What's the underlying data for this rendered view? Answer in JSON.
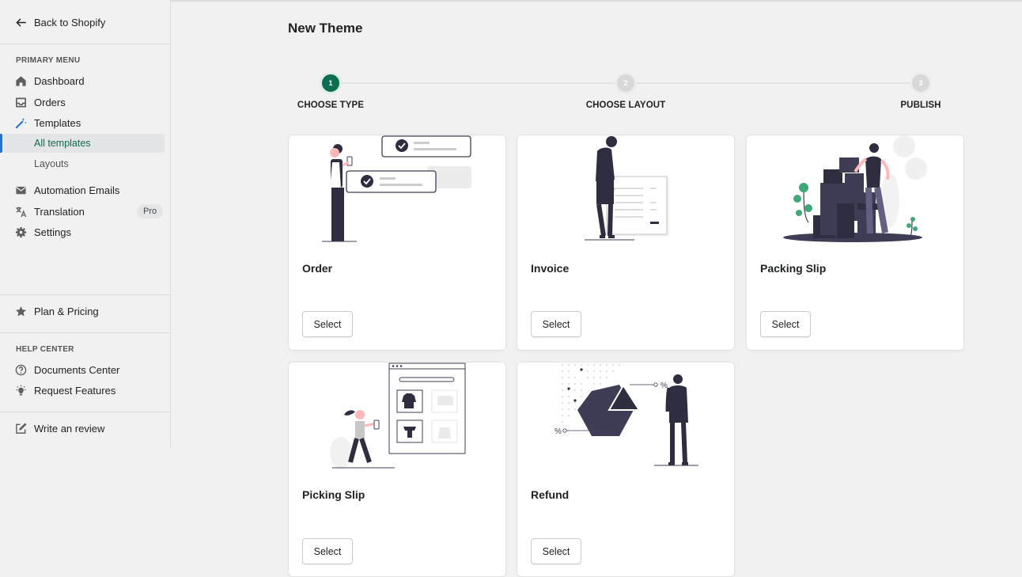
{
  "colors": {
    "accent": "#0b6e50",
    "active_bar": "#2c6ecb",
    "dark_figure": "#3f3d56"
  },
  "sidebar": {
    "back_label": "Back to Shopify",
    "primary_heading": "PRIMARY MENU",
    "items": [
      {
        "label": "Dashboard",
        "icon": "home-icon"
      },
      {
        "label": "Orders",
        "icon": "inbox-icon"
      },
      {
        "label": "Templates",
        "icon": "magic-wand-icon"
      }
    ],
    "sub_items": [
      {
        "label": "All templates",
        "active": true
      },
      {
        "label": "Layouts",
        "active": false
      }
    ],
    "items2": [
      {
        "label": "Automation Emails",
        "icon": "envelope-icon"
      },
      {
        "label": "Translation",
        "icon": "translate-icon",
        "badge": "Pro"
      },
      {
        "label": "Settings",
        "icon": "gear-icon"
      }
    ],
    "plan_label": "Plan & Pricing",
    "help_heading": "HELP CENTER",
    "help_items": [
      {
        "label": "Documents Center",
        "icon": "question-circle-icon"
      },
      {
        "label": "Request Features",
        "icon": "lightbulb-icon"
      }
    ],
    "review_label": "Write an review"
  },
  "main": {
    "title": "New Theme",
    "steps": [
      {
        "number": "1",
        "label": "CHOOSE TYPE",
        "state": "active"
      },
      {
        "number": "2",
        "label": "CHOOSE LAYOUT",
        "state": "pending"
      },
      {
        "number": "3",
        "label": "PUBLISH",
        "state": "pending"
      }
    ],
    "cards": [
      {
        "title": "Order",
        "button": "Select",
        "illustration": "order-illustration"
      },
      {
        "title": "Invoice",
        "button": "Select",
        "illustration": "invoice-illustration"
      },
      {
        "title": "Packing Slip",
        "button": "Select",
        "illustration": "packing-slip-illustration"
      },
      {
        "title": "Picking Slip",
        "button": "Select",
        "illustration": "picking-slip-illustration"
      },
      {
        "title": "Refund",
        "button": "Select",
        "illustration": "refund-illustration"
      }
    ],
    "illustration_text": {
      "percent": "%"
    }
  }
}
